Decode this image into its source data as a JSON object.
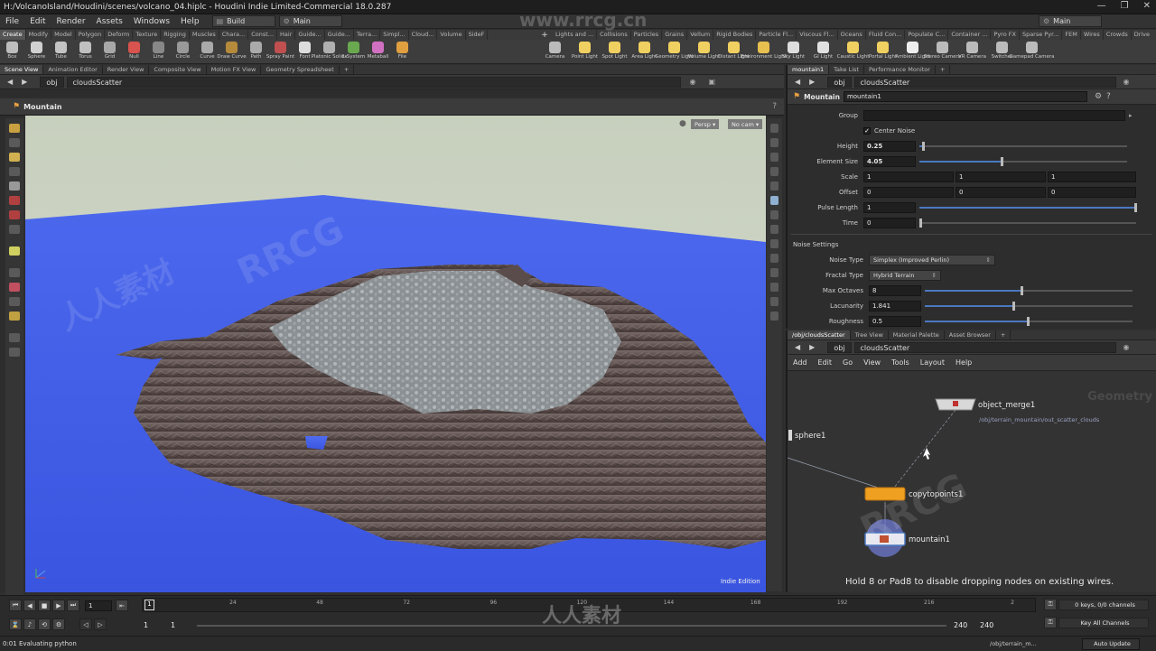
{
  "window": {
    "title": "H:/VolcanoIsland/Houdini/scenes/volcano_04.hiplc - Houdini Indie Limited-Commercial 18.0.287",
    "controls": [
      "—",
      "❐",
      "✕"
    ]
  },
  "menubar": {
    "items": [
      "File",
      "Edit",
      "Render",
      "Assets",
      "Windows",
      "Help"
    ],
    "build_desktop": "Build",
    "main_dropdown": "Main",
    "right_desktop": "Main"
  },
  "shelf_tabs_left": [
    "Create",
    "Modify",
    "Model",
    "Polygon",
    "Deform",
    "Texture",
    "Rigging",
    "Muscles",
    "Chara...",
    "Const...",
    "Hair",
    "Guide...",
    "Guide...",
    "Terra...",
    "Simpl...",
    "Cloud...",
    "Volume",
    "SideF"
  ],
  "shelf_tabs_right": [
    "Lights and ...",
    "Collisions",
    "Particles",
    "Grains",
    "Vellum",
    "Rigid Bodies",
    "Particle Fl...",
    "Viscous Fl...",
    "Oceans",
    "Fluid Con...",
    "Populate C...",
    "Container ...",
    "Pyro FX",
    "Sparse Pyr...",
    "FEM",
    "Wires",
    "Crowds",
    "Drive Sim..."
  ],
  "shelf_tools_left": [
    {
      "label": "Box",
      "color": "#bdbdbd"
    },
    {
      "label": "Sphere",
      "color": "#d0d0d0"
    },
    {
      "label": "Tube",
      "color": "#c4c4c4"
    },
    {
      "label": "Torus",
      "color": "#c0c0c0"
    },
    {
      "label": "Grid",
      "color": "#a8a8a8"
    },
    {
      "label": "Null",
      "color": "#d9534f"
    },
    {
      "label": "Line",
      "color": "#888888"
    },
    {
      "label": "Circle",
      "color": "#999999"
    },
    {
      "label": "Curve",
      "color": "#aaaaaa"
    },
    {
      "label": "Draw Curve",
      "color": "#b58a3a"
    },
    {
      "label": "Path",
      "color": "#aaaaaa"
    },
    {
      "label": "Spray Paint",
      "color": "#c05050"
    },
    {
      "label": "Font",
      "color": "#dddddd"
    },
    {
      "label": "Platonic Solids",
      "color": "#b0b0b0"
    },
    {
      "label": "L-System",
      "color": "#6aa84f"
    },
    {
      "label": "Metaball",
      "color": "#d070c0"
    },
    {
      "label": "File",
      "color": "#e0a040"
    }
  ],
  "shelf_tools_right": [
    {
      "label": "Camera",
      "color": "#bbbbbb"
    },
    {
      "label": "Point Light",
      "color": "#f0d060"
    },
    {
      "label": "Spot Light",
      "color": "#f0d060"
    },
    {
      "label": "Area Light",
      "color": "#f0d060"
    },
    {
      "label": "Geometry Light",
      "color": "#f0d060"
    },
    {
      "label": "Volume Light",
      "color": "#f0d060"
    },
    {
      "label": "Distant Light",
      "color": "#f0d060"
    },
    {
      "label": "Environment Light",
      "color": "#e8c050"
    },
    {
      "label": "Sky Light",
      "color": "#dddddd"
    },
    {
      "label": "GI Light",
      "color": "#e0e0e0"
    },
    {
      "label": "Caustic Light",
      "color": "#f0d060"
    },
    {
      "label": "Portal Light",
      "color": "#f0d060"
    },
    {
      "label": "Ambient Light",
      "color": "#eeeeee"
    },
    {
      "label": "Stereo Camera",
      "color": "#bbbbbb"
    },
    {
      "label": "VR Camera",
      "color": "#bbbbbb"
    },
    {
      "label": "Switcher",
      "color": "#bbbbbb"
    },
    {
      "label": "Gamepad Camera",
      "color": "#bbbbbb"
    }
  ],
  "left_pane": {
    "tabs": [
      "Scene View",
      "Animation Editor",
      "Render View",
      "Composite View",
      "Motion FX View",
      "Geometry Spreadsheet"
    ],
    "path_root": "obj",
    "path_node": "cloudsScatter",
    "viewport_title": "Mountain",
    "persp": "Persp ▾",
    "cam": "No cam ▾",
    "edition": "Indie Edition"
  },
  "param_pane": {
    "tabs": [
      "mountain1",
      "Take List",
      "Performance Monitor"
    ],
    "path_root": "obj",
    "path_node": "cloudsScatter",
    "node_type": "Mountain",
    "node_name": "mountain1",
    "group_label": "Group",
    "center_noise_label": "Center Noise",
    "height": {
      "label": "Height",
      "value": "0.25",
      "fraction": 0.02
    },
    "element_size": {
      "label": "Element Size",
      "value": "4.05",
      "fraction": 0.4
    },
    "scale": {
      "label": "Scale",
      "values": [
        "1",
        "1",
        "1"
      ]
    },
    "offset": {
      "label": "Offset",
      "values": [
        "0",
        "0",
        "0"
      ]
    },
    "pulse_length": {
      "label": "Pulse Length",
      "value": "1",
      "fraction": 1.0
    },
    "time": {
      "label": "Time",
      "value": "0",
      "fraction": 0.0
    },
    "noise_section": "Noise Settings",
    "noise_type": {
      "label": "Noise Type",
      "value": "Simplex (Improved Perlin)"
    },
    "fractal_type": {
      "label": "Fractal Type",
      "value": "Hybrid Terrain"
    },
    "max_octaves": {
      "label": "Max Octaves",
      "value": "8",
      "fraction": 0.47
    },
    "lacunarity": {
      "label": "Lacunarity",
      "value": "1.841",
      "fraction": 0.43
    },
    "roughness": {
      "label": "Roughness",
      "value": "0.5",
      "fraction": 0.5
    }
  },
  "network_pane": {
    "tabs": [
      "/obj/cloudsScatter",
      "Tree View",
      "Material Palette",
      "Asset Browser"
    ],
    "path_root": "obj",
    "path_node": "cloudsScatter",
    "menu": [
      "Add",
      "Edit",
      "Go",
      "View",
      "Tools",
      "Layout",
      "Help"
    ],
    "context_label": "Geometry",
    "nodes": {
      "object_merge": "object_merge1",
      "object_merge_path": "/obj/terrain_mountain/out_scatter_clouds",
      "sphere": "sphere1",
      "copytopoints": "copytopoints1",
      "mountain": "mountain1"
    },
    "hint": "Hold 8 or Pad8 to disable dropping nodes on existing wires."
  },
  "timeline": {
    "current_frame": "1",
    "start_frame": "1",
    "start_frame_2": "1",
    "ticks": [
      "1",
      "24",
      "48",
      "72",
      "96",
      "120",
      "144",
      "168",
      "192",
      "216",
      "2"
    ],
    "end_frame": "240",
    "end_frame_2": "240",
    "keys_channels": "0 keys, 0/0 channels",
    "key_all": "Key All Channels",
    "auto_update": "Auto Update",
    "path_status": "/obj/terrain_m...",
    "status": "0:01 Evaluating python"
  },
  "watermarks": [
    "www.rrcg.cn",
    "RRCG",
    "人人素材"
  ],
  "colors": {
    "sky": "#c9d0bf",
    "water": "#3f5fe8",
    "node_orange": "#f0a020",
    "accent_blue": "#4a78c0"
  }
}
